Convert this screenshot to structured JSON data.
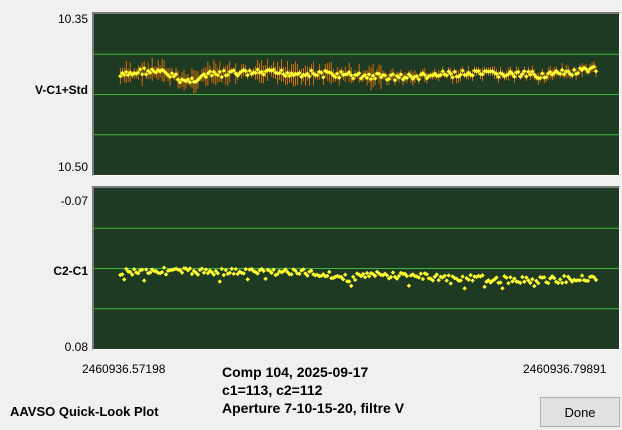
{
  "app_title": "AAVSO Quick-Look Plot",
  "done_label": "Done",
  "info": {
    "line1": "Comp 104, 2025-09-17",
    "line2": "c1=113, c2=112",
    "line3": "Aperture 7-10-15-20, filtre V"
  },
  "colors": {
    "plot_bg": "#1f3a23",
    "grid": "#3db83d",
    "point": "#ffff33",
    "error_bar": "#ff7a00"
  },
  "chart_data": [
    {
      "type": "scatter",
      "ylabel": "V-C1+Std",
      "ylim": [
        10.35,
        10.5
      ],
      "y_inverted": true,
      "ytick_labels": [
        "10.35",
        "10.50"
      ],
      "xlim": [
        2460936.57198,
        2460936.79891
      ],
      "xtick_labels": [
        "2460936.57198",
        "2460936.79891"
      ],
      "grid": true,
      "error_bars": true,
      "trend": [
        {
          "x": 2460936.574,
          "y": 10.408
        },
        {
          "x": 2460936.585,
          "y": 10.403
        },
        {
          "x": 2460936.595,
          "y": 10.405
        },
        {
          "x": 2460936.605,
          "y": 10.413
        },
        {
          "x": 2460936.615,
          "y": 10.407
        },
        {
          "x": 2460936.63,
          "y": 10.405
        },
        {
          "x": 2460936.65,
          "y": 10.405
        },
        {
          "x": 2460936.67,
          "y": 10.406
        },
        {
          "x": 2460936.69,
          "y": 10.408
        },
        {
          "x": 2460936.71,
          "y": 10.409
        },
        {
          "x": 2460936.73,
          "y": 10.406
        },
        {
          "x": 2460936.75,
          "y": 10.406
        },
        {
          "x": 2460936.77,
          "y": 10.407
        },
        {
          "x": 2460936.785,
          "y": 10.405
        },
        {
          "x": 2460936.7975,
          "y": 10.402
        }
      ]
    },
    {
      "type": "scatter",
      "ylabel": "C2-C1",
      "ylim": [
        -0.07,
        0.08
      ],
      "ytick_labels": [
        "-0.07",
        "0.08"
      ],
      "xlim": [
        2460936.57198,
        2460936.79891
      ],
      "xtick_labels": [
        "2460936.57198",
        "2460936.79891"
      ],
      "grid": true,
      "error_bars": false,
      "trend": [
        {
          "x": 2460936.574,
          "y": 0.008
        },
        {
          "x": 2460936.59,
          "y": 0.007
        },
        {
          "x": 2460936.61,
          "y": 0.008
        },
        {
          "x": 2460936.63,
          "y": 0.008
        },
        {
          "x": 2460936.65,
          "y": 0.008
        },
        {
          "x": 2460936.67,
          "y": 0.01
        },
        {
          "x": 2460936.68,
          "y": 0.014
        },
        {
          "x": 2460936.69,
          "y": 0.011
        },
        {
          "x": 2460936.71,
          "y": 0.012
        },
        {
          "x": 2460936.73,
          "y": 0.014
        },
        {
          "x": 2460936.75,
          "y": 0.015
        },
        {
          "x": 2460936.77,
          "y": 0.016
        },
        {
          "x": 2460936.785,
          "y": 0.015
        },
        {
          "x": 2460936.7975,
          "y": 0.013
        }
      ]
    }
  ]
}
